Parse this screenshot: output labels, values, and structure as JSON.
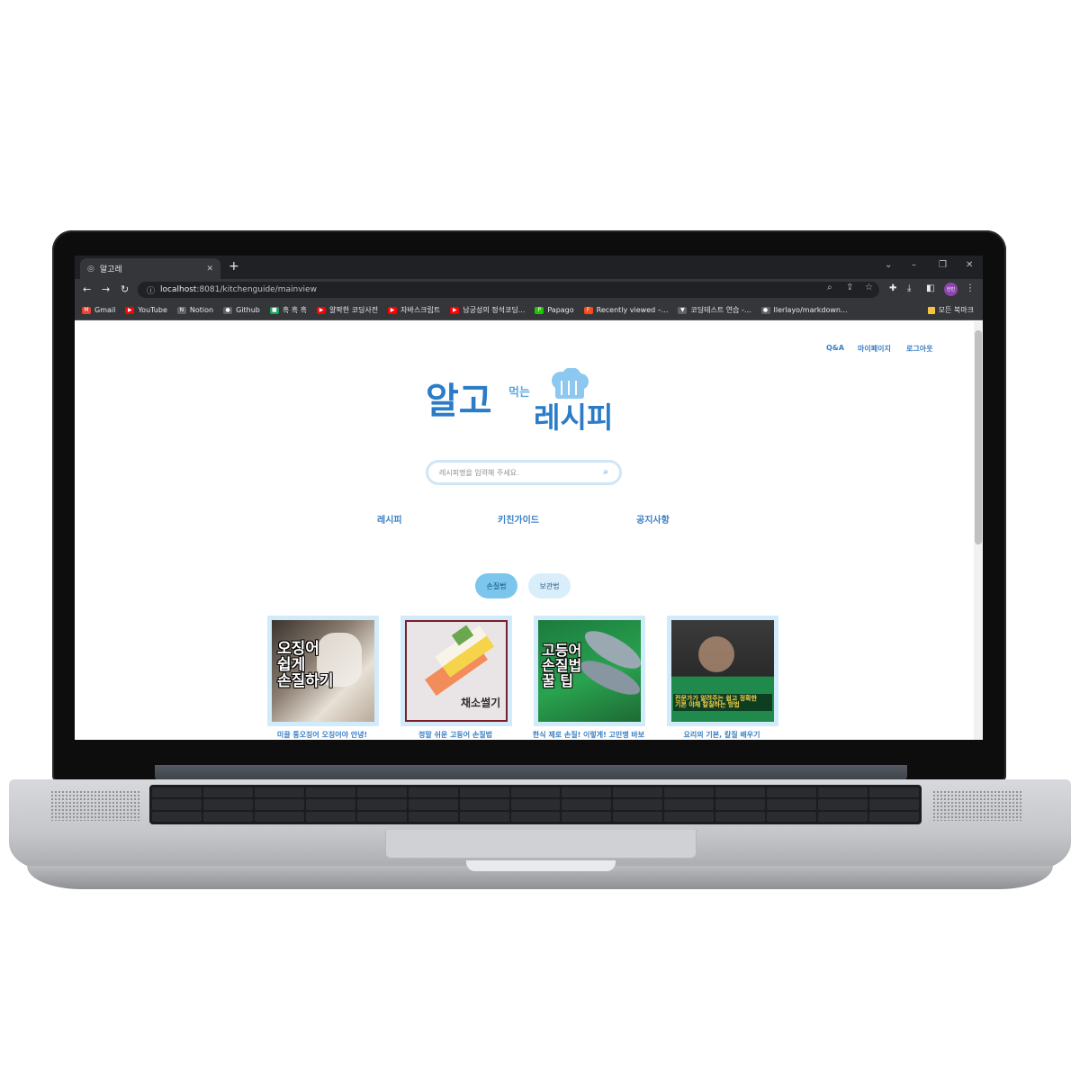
{
  "browser": {
    "tab_title": "알고레",
    "url_host": "localhost",
    "url_rest": ":8081/kitchenguide/mainview",
    "profile_label": "한빈",
    "bookmarks": [
      {
        "label": "Gmail",
        "color": "#ea4335",
        "icon": "gmail-icon"
      },
      {
        "label": "YouTube",
        "color": "#ff0000",
        "icon": "youtube-icon"
      },
      {
        "label": "Notion",
        "color": "#5f6368",
        "icon": "notion-icon"
      },
      {
        "label": "Github",
        "color": "#5f6368",
        "icon": "github-icon"
      },
      {
        "label": "흑 흑 흑",
        "color": "#1ea362",
        "icon": "line-icon"
      },
      {
        "label": "얄팍한 코딩사전",
        "color": "#ff0000",
        "icon": "youtube-icon"
      },
      {
        "label": "자바스크립트",
        "color": "#ff0000",
        "icon": "youtube-icon"
      },
      {
        "label": "남궁성의 정석코딩...",
        "color": "#ff0000",
        "icon": "youtube-icon"
      },
      {
        "label": "Papago",
        "color": "#1ec800",
        "icon": "papago-icon"
      },
      {
        "label": "Recently viewed –...",
        "color": "#f24e1e",
        "icon": "figma-icon"
      },
      {
        "label": "코딩테스트 연습 -...",
        "color": "#5f6368",
        "icon": "programmers-icon"
      },
      {
        "label": "Ilerlayo/markdown...",
        "color": "#5f6368",
        "icon": "github-icon"
      }
    ],
    "all_bookmarks_label": "모든 북마크"
  },
  "header": {
    "links": [
      "Q&A",
      "마이페이지",
      "로그아웃"
    ]
  },
  "logo": {
    "word1": "알고",
    "word2": "먹는",
    "word3": "레시피"
  },
  "search": {
    "placeholder": "레시피명을 입력해 주세요."
  },
  "menu": [
    "레시피",
    "키친가이드",
    "공지사항"
  ],
  "filters": {
    "active": "손질법",
    "inactive": "보관법"
  },
  "cards": [
    {
      "caption": "미끌 통오징어 오징어야 안녕!",
      "thumb_text": "오징어\n쉽게\n손질하기"
    },
    {
      "caption": "정말 쉬운 고등어 손질법",
      "thumb_text": "채소썰기"
    },
    {
      "caption": "한식 제로 손질! 이렇게! 고민맹 바보",
      "thumb_text": "고등어\n손질법\n꿀 팁"
    },
    {
      "caption": "요리의 기본, 칼질 배우기",
      "thumb_text": "전문가가 알려주는 쉽고 정확한\n기본 야채 칼질하는 방법"
    }
  ],
  "colors": {
    "accent": "#3a7fc4",
    "logo_blue": "#2a7cc7",
    "pill_active": "#7cc6ee",
    "pill_inactive": "#d9eefb",
    "card_frame": "#d2ebfb"
  }
}
